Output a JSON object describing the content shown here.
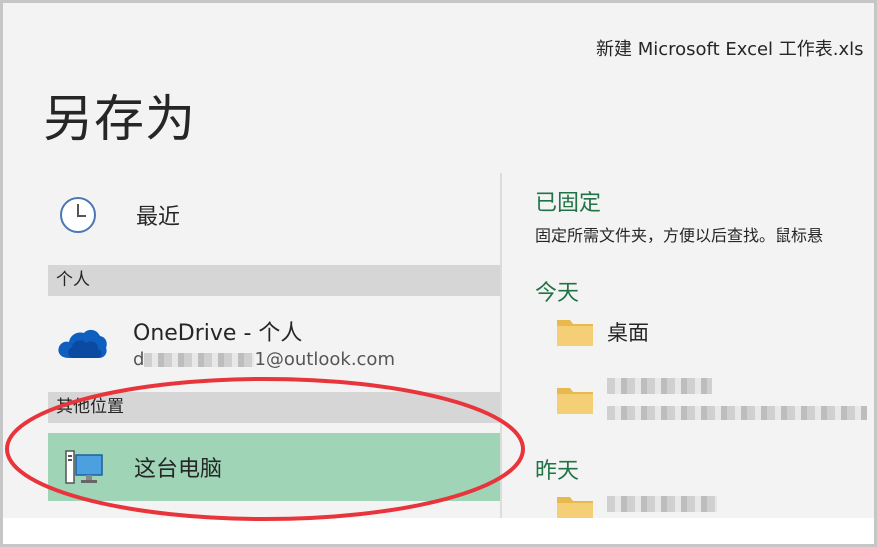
{
  "window": {
    "doc_title": "新建 Microsoft Excel 工作表.xls"
  },
  "page": {
    "title": "另存为"
  },
  "nav": {
    "recent_label": "最近",
    "personal_header": "个人",
    "onedrive_title": "OneDrive - 个人",
    "onedrive_email_prefix": "d",
    "onedrive_email_suffix": "1@outlook.com",
    "other_header": "其他位置",
    "this_pc_label": "这台电脑"
  },
  "right": {
    "pinned_heading": "已固定",
    "pinned_desc": "固定所需文件夹，方便以后查找。鼠标悬",
    "today_heading": "今天",
    "today_folders": [
      "桌面"
    ],
    "yesterday_heading": "昨天"
  },
  "colors": {
    "accent": "#217346",
    "selected_bg": "#9fd5b6",
    "annotation": "#e8353b"
  }
}
